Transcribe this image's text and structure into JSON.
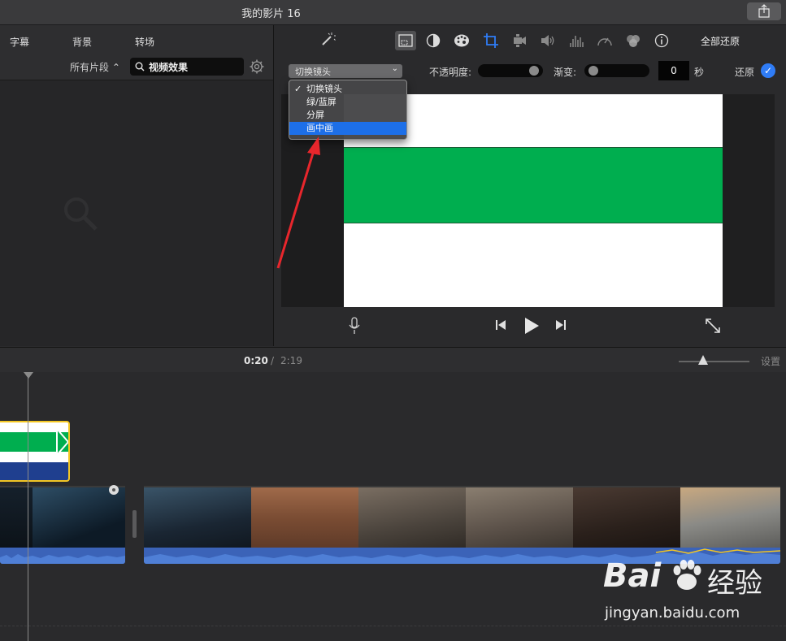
{
  "window": {
    "title": "我的影片 16"
  },
  "browser": {
    "tabs": [
      "字幕",
      "背景",
      "转场"
    ],
    "filter": "所有片段 ⌃",
    "search": {
      "value": "视频效果"
    }
  },
  "viewer": {
    "toolbar": {
      "icons": [
        "magic-wand",
        "video-overlay",
        "color-balance",
        "color-correction",
        "crop",
        "stabilization",
        "volume",
        "noise-equalizer",
        "speed",
        "clip-filter",
        "info"
      ],
      "reset_all": "全部还原"
    },
    "overlay_controls": {
      "style_selected": "切换镜头",
      "opacity_label": "不透明度:",
      "opacity_level": 0.95,
      "fade_label": "渐变:",
      "fade_level": 0.05,
      "fade_value": "0",
      "fade_unit": "秒",
      "reset_label": "还原",
      "reset_checked": true
    },
    "style_menu": {
      "items": [
        {
          "label": "切换镜头",
          "checked": true
        },
        {
          "label": "绿/蓝屏",
          "checked": false
        },
        {
          "label": "分屏",
          "checked": false
        },
        {
          "label": "画中画",
          "checked": false,
          "highlighted": true
        }
      ],
      "checkmark": "✓"
    },
    "playback": {
      "icons": [
        "microphone",
        "previous",
        "play",
        "next",
        "fullscreen"
      ]
    }
  },
  "timeline": {
    "time_current": "0:20",
    "time_sep": "/",
    "time_total": "2:19",
    "settings_label": "设置",
    "zoom_level": 0.35
  },
  "watermark": {
    "brand": "Bai",
    "brand_suffix": "经验",
    "url": "jingyan.baidu.com"
  },
  "colors": {
    "accent": "#1d6fe8",
    "preview_green": "#00ae4f",
    "clip_selection": "#f3c623",
    "audio_wave": "#3b63b8",
    "annotation_arrow": "#e8262c"
  }
}
